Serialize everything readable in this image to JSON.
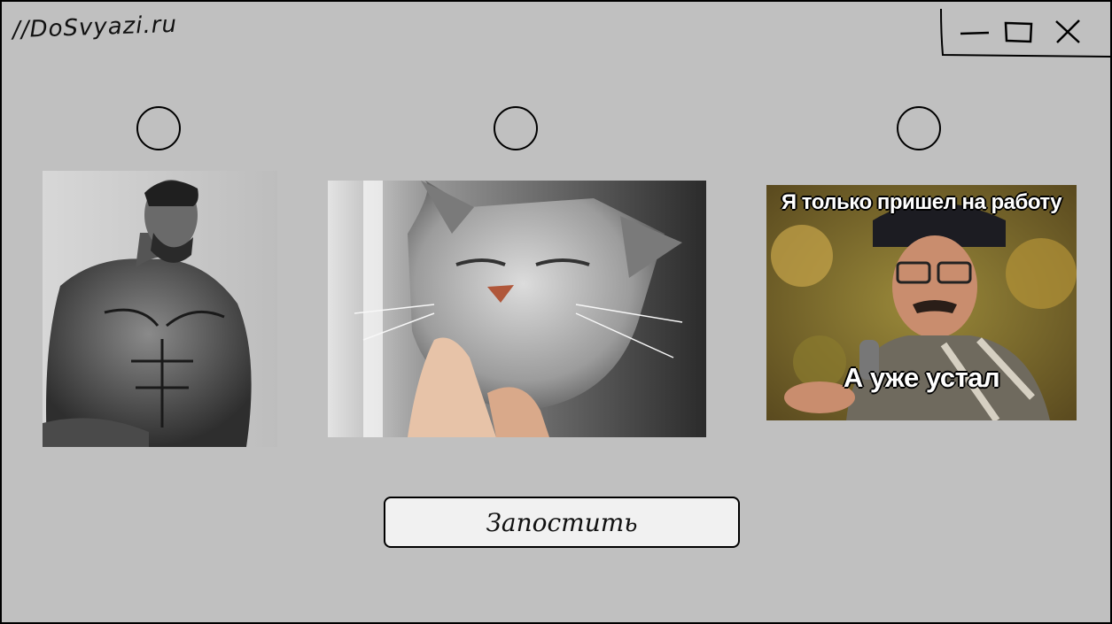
{
  "app": {
    "brand": "//DoSvyazi.ru"
  },
  "window_controls": {
    "minimize_icon": "minimize-icon",
    "maximize_icon": "maximize-icon",
    "close_icon": "close-icon"
  },
  "options": [
    {
      "selected": false,
      "image": "muscular-man-photo"
    },
    {
      "selected": false,
      "image": "cat-being-petted-photo"
    },
    {
      "selected": false,
      "image": "meme-photo"
    }
  ],
  "meme": {
    "top_text": "Я только пришел на работу",
    "bottom_text": "А уже устал"
  },
  "actions": {
    "post_label": "Запостить"
  },
  "colors": {
    "background": "#c0c0c0",
    "button_bg": "#f1f1f1",
    "border": "#000000"
  }
}
